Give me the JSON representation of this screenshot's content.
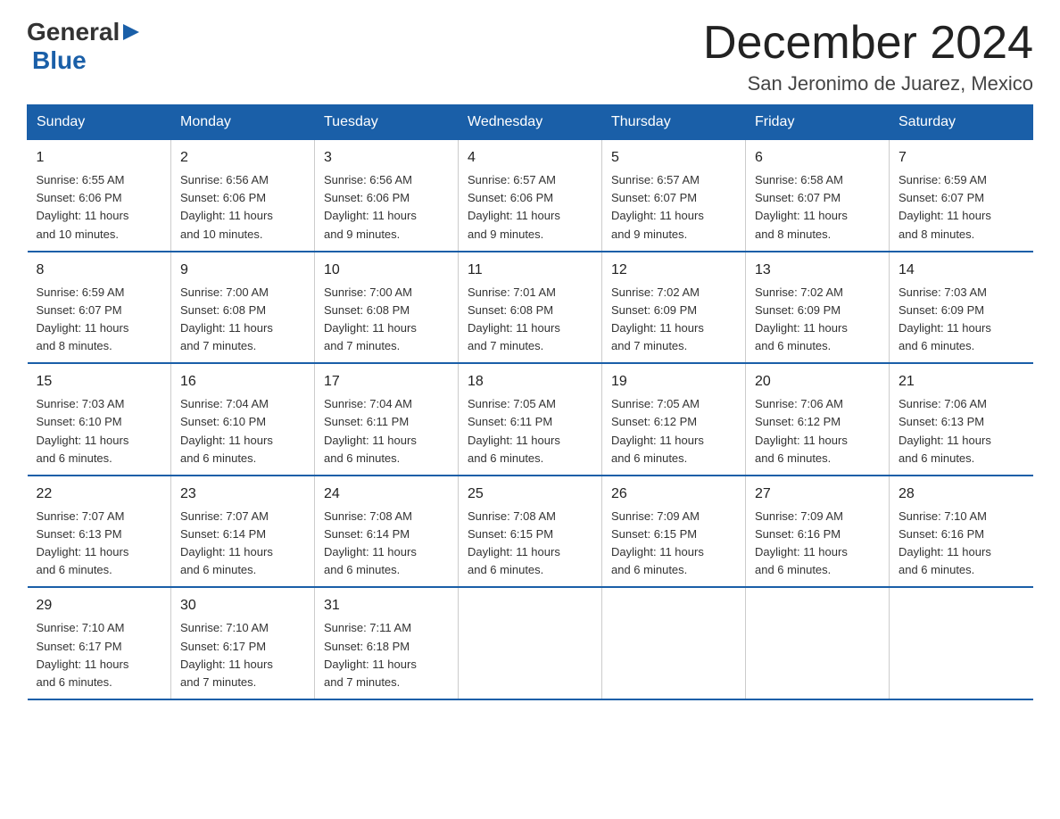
{
  "header": {
    "logo_general": "General",
    "logo_blue": "Blue",
    "month_title": "December 2024",
    "location": "San Jeronimo de Juarez, Mexico"
  },
  "days_of_week": [
    "Sunday",
    "Monday",
    "Tuesday",
    "Wednesday",
    "Thursday",
    "Friday",
    "Saturday"
  ],
  "weeks": [
    [
      {
        "day": "1",
        "sunrise": "6:55 AM",
        "sunset": "6:06 PM",
        "daylight": "11 hours and 10 minutes."
      },
      {
        "day": "2",
        "sunrise": "6:56 AM",
        "sunset": "6:06 PM",
        "daylight": "11 hours and 10 minutes."
      },
      {
        "day": "3",
        "sunrise": "6:56 AM",
        "sunset": "6:06 PM",
        "daylight": "11 hours and 9 minutes."
      },
      {
        "day": "4",
        "sunrise": "6:57 AM",
        "sunset": "6:06 PM",
        "daylight": "11 hours and 9 minutes."
      },
      {
        "day": "5",
        "sunrise": "6:57 AM",
        "sunset": "6:07 PM",
        "daylight": "11 hours and 9 minutes."
      },
      {
        "day": "6",
        "sunrise": "6:58 AM",
        "sunset": "6:07 PM",
        "daylight": "11 hours and 8 minutes."
      },
      {
        "day": "7",
        "sunrise": "6:59 AM",
        "sunset": "6:07 PM",
        "daylight": "11 hours and 8 minutes."
      }
    ],
    [
      {
        "day": "8",
        "sunrise": "6:59 AM",
        "sunset": "6:07 PM",
        "daylight": "11 hours and 8 minutes."
      },
      {
        "day": "9",
        "sunrise": "7:00 AM",
        "sunset": "6:08 PM",
        "daylight": "11 hours and 7 minutes."
      },
      {
        "day": "10",
        "sunrise": "7:00 AM",
        "sunset": "6:08 PM",
        "daylight": "11 hours and 7 minutes."
      },
      {
        "day": "11",
        "sunrise": "7:01 AM",
        "sunset": "6:08 PM",
        "daylight": "11 hours and 7 minutes."
      },
      {
        "day": "12",
        "sunrise": "7:02 AM",
        "sunset": "6:09 PM",
        "daylight": "11 hours and 7 minutes."
      },
      {
        "day": "13",
        "sunrise": "7:02 AM",
        "sunset": "6:09 PM",
        "daylight": "11 hours and 6 minutes."
      },
      {
        "day": "14",
        "sunrise": "7:03 AM",
        "sunset": "6:09 PM",
        "daylight": "11 hours and 6 minutes."
      }
    ],
    [
      {
        "day": "15",
        "sunrise": "7:03 AM",
        "sunset": "6:10 PM",
        "daylight": "11 hours and 6 minutes."
      },
      {
        "day": "16",
        "sunrise": "7:04 AM",
        "sunset": "6:10 PM",
        "daylight": "11 hours and 6 minutes."
      },
      {
        "day": "17",
        "sunrise": "7:04 AM",
        "sunset": "6:11 PM",
        "daylight": "11 hours and 6 minutes."
      },
      {
        "day": "18",
        "sunrise": "7:05 AM",
        "sunset": "6:11 PM",
        "daylight": "11 hours and 6 minutes."
      },
      {
        "day": "19",
        "sunrise": "7:05 AM",
        "sunset": "6:12 PM",
        "daylight": "11 hours and 6 minutes."
      },
      {
        "day": "20",
        "sunrise": "7:06 AM",
        "sunset": "6:12 PM",
        "daylight": "11 hours and 6 minutes."
      },
      {
        "day": "21",
        "sunrise": "7:06 AM",
        "sunset": "6:13 PM",
        "daylight": "11 hours and 6 minutes."
      }
    ],
    [
      {
        "day": "22",
        "sunrise": "7:07 AM",
        "sunset": "6:13 PM",
        "daylight": "11 hours and 6 minutes."
      },
      {
        "day": "23",
        "sunrise": "7:07 AM",
        "sunset": "6:14 PM",
        "daylight": "11 hours and 6 minutes."
      },
      {
        "day": "24",
        "sunrise": "7:08 AM",
        "sunset": "6:14 PM",
        "daylight": "11 hours and 6 minutes."
      },
      {
        "day": "25",
        "sunrise": "7:08 AM",
        "sunset": "6:15 PM",
        "daylight": "11 hours and 6 minutes."
      },
      {
        "day": "26",
        "sunrise": "7:09 AM",
        "sunset": "6:15 PM",
        "daylight": "11 hours and 6 minutes."
      },
      {
        "day": "27",
        "sunrise": "7:09 AM",
        "sunset": "6:16 PM",
        "daylight": "11 hours and 6 minutes."
      },
      {
        "day": "28",
        "sunrise": "7:10 AM",
        "sunset": "6:16 PM",
        "daylight": "11 hours and 6 minutes."
      }
    ],
    [
      {
        "day": "29",
        "sunrise": "7:10 AM",
        "sunset": "6:17 PM",
        "daylight": "11 hours and 6 minutes."
      },
      {
        "day": "30",
        "sunrise": "7:10 AM",
        "sunset": "6:17 PM",
        "daylight": "11 hours and 7 minutes."
      },
      {
        "day": "31",
        "sunrise": "7:11 AM",
        "sunset": "6:18 PM",
        "daylight": "11 hours and 7 minutes."
      },
      null,
      null,
      null,
      null
    ]
  ],
  "labels": {
    "sunrise": "Sunrise:",
    "sunset": "Sunset:",
    "daylight": "Daylight:"
  }
}
